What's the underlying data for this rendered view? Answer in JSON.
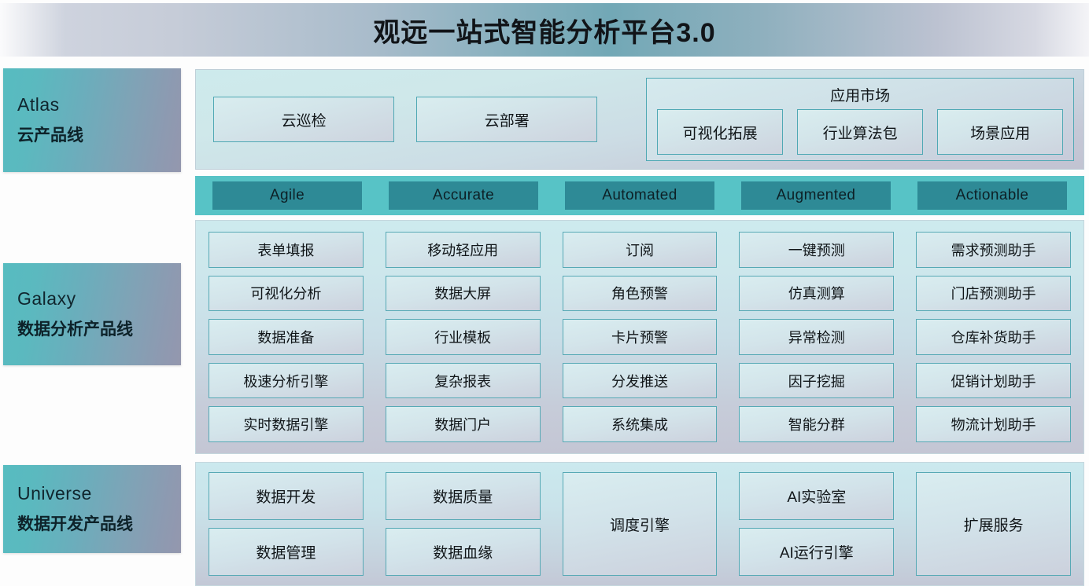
{
  "header": {
    "title": "观远一站式智能分析平台3.0"
  },
  "rail": {
    "items": [
      {
        "en": "Atlas",
        "cn": "云产品线"
      },
      {
        "en": "Galaxy",
        "cn": "数据分析产品线"
      },
      {
        "en": "Universe",
        "cn": "数据开发产品线"
      }
    ]
  },
  "atlas": {
    "cloud_inspect": "云巡检",
    "cloud_deploy": "云部署",
    "app_market": {
      "title": "应用市场",
      "items": [
        "可视化拓展",
        "行业算法包",
        "场景应用"
      ]
    }
  },
  "capability_bar": {
    "items": [
      "Agile",
      "Accurate",
      "Automated",
      "Augmented",
      "Actionable"
    ]
  },
  "galaxy": {
    "columns": [
      {
        "header": "Agile",
        "items": [
          "表单填报",
          "可视化分析",
          "数据准备",
          "极速分析引擎",
          "实时数据引擎"
        ]
      },
      {
        "header": "Accurate",
        "items": [
          "移动轻应用",
          "数据大屏",
          "行业模板",
          "复杂报表",
          "数据门户"
        ]
      },
      {
        "header": "Automated",
        "items": [
          "订阅",
          "角色预警",
          "卡片预警",
          "分发推送",
          "系统集成"
        ]
      },
      {
        "header": "Augmented",
        "items": [
          "一键预测",
          "仿真测算",
          "异常检测",
          "因子挖掘",
          "智能分群"
        ]
      },
      {
        "header": "Actionable",
        "items": [
          "需求预测助手",
          "门店预测助手",
          "仓库补货助手",
          "促销计划助手",
          "物流计划助手"
        ]
      }
    ]
  },
  "universe": {
    "col1": [
      "数据开发",
      "数据管理"
    ],
    "col2": [
      "数据质量",
      "数据血缘"
    ],
    "col3": "调度引擎",
    "col4": [
      "AI实验室",
      "AI运行引擎"
    ],
    "col5": "扩展服务"
  },
  "colors": {
    "accent_teal": "#57c3c6",
    "chip_teal": "#2e8a96",
    "cell_border": "#57a9b5",
    "rail_gradient_start": "#57bcc0",
    "rail_gradient_end": "#9497ae"
  }
}
